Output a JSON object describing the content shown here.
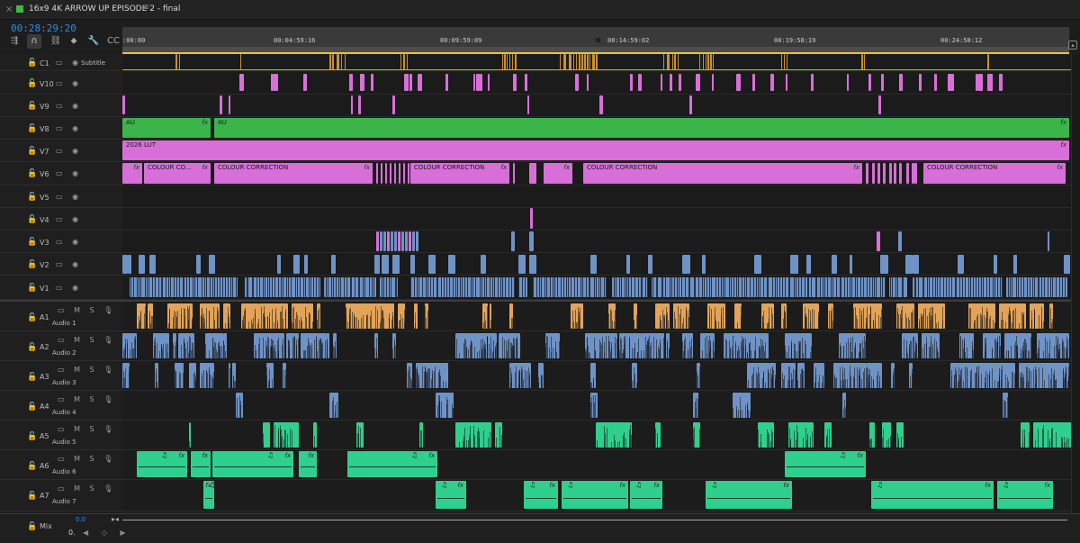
{
  "tab": {
    "close_glyph": "×",
    "title": "16x9 4K ARROW UP EPISODE 2 - final",
    "menu_glyph": "≡",
    "swatch_color": "#3fb845"
  },
  "playhead_timecode": "00:28:29:20",
  "tools": [
    {
      "name": "insert-overwrite-tool-icon",
      "glyph": "⇶"
    },
    {
      "name": "snap-magnet-icon",
      "glyph": "∩"
    },
    {
      "name": "linked-selection-icon",
      "glyph": "⛓"
    },
    {
      "name": "add-marker-icon",
      "glyph": "⬥"
    },
    {
      "name": "wrench-settings-icon",
      "glyph": "🔧"
    },
    {
      "name": "captions-icon",
      "glyph": "CC"
    }
  ],
  "ruler": {
    "labels": [
      ":00:00",
      "00:04:59:16",
      "00:09:59:09",
      "00:14:59:02",
      "00:19:58:19",
      "00:24:58:12"
    ]
  },
  "tracks": [
    {
      "id": "C1",
      "kind": "caption",
      "sub": "Subtitle"
    },
    {
      "id": "V10",
      "kind": "video"
    },
    {
      "id": "V9",
      "kind": "video"
    },
    {
      "id": "V8",
      "kind": "video"
    },
    {
      "id": "V7",
      "kind": "video"
    },
    {
      "id": "V6",
      "kind": "video"
    },
    {
      "id": "V5",
      "kind": "video"
    },
    {
      "id": "V4",
      "kind": "video"
    },
    {
      "id": "V3",
      "kind": "video"
    },
    {
      "id": "V2",
      "kind": "video"
    },
    {
      "id": "V1",
      "kind": "video"
    },
    {
      "id": "A1",
      "kind": "audio",
      "sub": "Audio 1"
    },
    {
      "id": "A2",
      "kind": "audio",
      "sub": "Audio 2"
    },
    {
      "id": "A3",
      "kind": "audio",
      "sub": "Audio 3"
    },
    {
      "id": "A4",
      "kind": "audio",
      "sub": "Audio 4"
    },
    {
      "id": "A5",
      "kind": "audio",
      "sub": "Audio 5"
    },
    {
      "id": "A6",
      "kind": "audio",
      "sub": "Audio 6"
    },
    {
      "id": "A7",
      "kind": "audio",
      "sub": "Audio 7"
    }
  ],
  "track_icons": {
    "lock": "🔓",
    "video": "▭ ◉",
    "audio": "▭ M S 🎙"
  },
  "clip_text": {
    "v8_label": "AU",
    "v8_label2": "AU",
    "v7_label": "2026 LUT",
    "v6_short": "COLOUR CO...",
    "v6_label": "COLOUR CORRECTION",
    "fx": "fx",
    "music_note": "♫"
  },
  "colors": {
    "video_blue": "#6f93c6",
    "audio_blue": "#6f93c6",
    "adjustment_pink": "#d86fd9",
    "au_green": "#3bb44a",
    "audio_orange": "#e3a45a",
    "audio_teal": "#2fcf8d",
    "caption_gold": "#c8912f"
  },
  "mix": {
    "label": "Mix",
    "value": "0.0",
    "value2": "0.",
    "controls": "◀ ◇ ▶",
    "end_glyph": "▸◂"
  }
}
